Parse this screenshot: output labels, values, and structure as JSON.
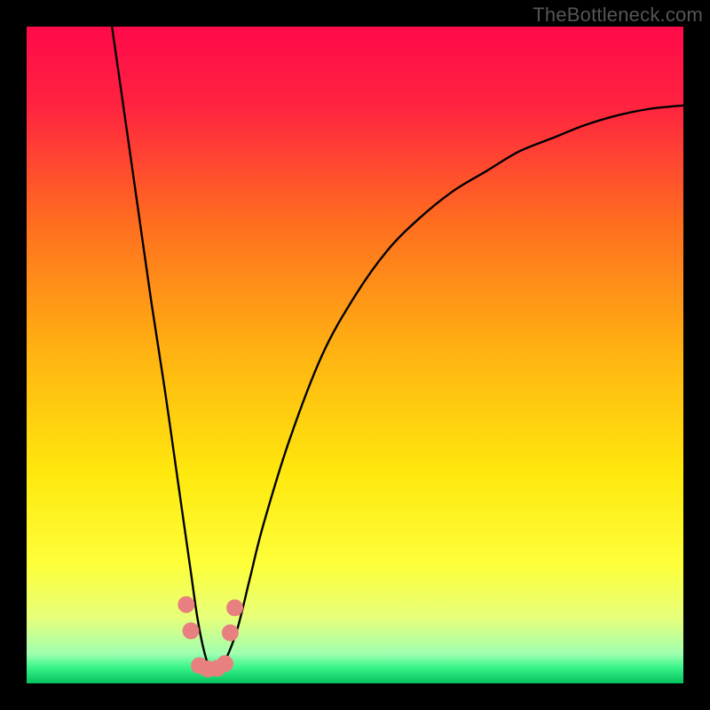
{
  "watermark": "TheBottleneck.com",
  "chart_data": {
    "type": "line",
    "title": "",
    "xlabel": "",
    "ylabel": "",
    "xlim": [
      0,
      100
    ],
    "ylim": [
      0,
      100
    ],
    "grid": false,
    "legend": null,
    "series": [
      {
        "name": "bottleneck-curve",
        "x": [
          13,
          15,
          17,
          19,
          21,
          23,
          24,
          25,
          26,
          27,
          28,
          29,
          30,
          32,
          34,
          36,
          40,
          45,
          50,
          55,
          60,
          65,
          70,
          75,
          80,
          85,
          90,
          95,
          100
        ],
        "y": [
          100,
          86,
          72,
          58,
          45,
          31,
          24,
          17,
          10,
          5,
          2,
          2,
          3,
          8,
          16,
          24,
          37,
          50,
          59,
          66,
          71,
          75,
          78,
          81,
          83,
          85,
          86.5,
          87.5,
          88
        ]
      }
    ],
    "markers": [
      {
        "name": "marker-left-upper",
        "x": 24.3,
        "y": 12.0
      },
      {
        "name": "marker-left-lower",
        "x": 25.0,
        "y": 8.0
      },
      {
        "name": "marker-right-upper",
        "x": 31.7,
        "y": 11.5
      },
      {
        "name": "marker-right-lower",
        "x": 31.0,
        "y": 7.7
      },
      {
        "name": "marker-trough-1",
        "x": 26.3,
        "y": 2.7
      },
      {
        "name": "marker-trough-2",
        "x": 27.6,
        "y": 2.2
      },
      {
        "name": "marker-trough-3",
        "x": 29.0,
        "y": 2.3
      },
      {
        "name": "marker-trough-4",
        "x": 30.2,
        "y": 3.0
      }
    ],
    "gradient_stops": [
      {
        "offset": 0.0,
        "color": "#ff0a4a"
      },
      {
        "offset": 0.12,
        "color": "#ff2340"
      },
      {
        "offset": 0.3,
        "color": "#ff6e1f"
      },
      {
        "offset": 0.5,
        "color": "#ffb411"
      },
      {
        "offset": 0.68,
        "color": "#ffe80e"
      },
      {
        "offset": 0.82,
        "color": "#fdff3a"
      },
      {
        "offset": 0.9,
        "color": "#e7ff7a"
      },
      {
        "offset": 0.955,
        "color": "#9fffb0"
      },
      {
        "offset": 0.975,
        "color": "#3bf58a"
      },
      {
        "offset": 1.0,
        "color": "#05c25e"
      }
    ],
    "marker_color": "#e98080",
    "curve_color": "#000000"
  }
}
